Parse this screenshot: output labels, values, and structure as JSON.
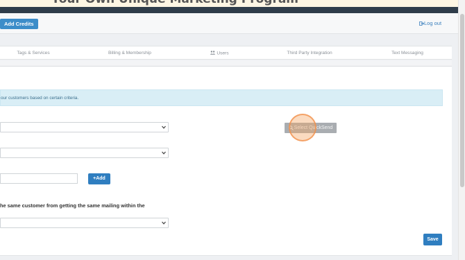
{
  "banner": {
    "text": "Your Own Unique Marketing Program"
  },
  "toolbar": {
    "add_credits_label": "Add Credits",
    "logout_label": "Log out"
  },
  "tabs": [
    {
      "label": "Tags & Services"
    },
    {
      "label": "Billing & Membership"
    },
    {
      "label": "Users"
    },
    {
      "label": "Third Party Integration"
    },
    {
      "label": "Text Messaging"
    }
  ],
  "info": {
    "text": "our customers based on certain criteria."
  },
  "buttons": {
    "select_quicksend": "Select QuickSend",
    "add": "+Add",
    "save": "Save"
  },
  "labels": {
    "same_customer": "he same customer from getting the same mailing within the"
  },
  "icons": {
    "logout": "logout-icon",
    "users": "users-icon",
    "search": "search-icon",
    "chevron": "chevron-down-icon"
  },
  "colors": {
    "primary": "#2f7ec0",
    "info_bg": "#d9eef6",
    "disabled_button": "#a9adb1",
    "click_indicator": "#f6a462",
    "dark_nav": "#2f3d4a"
  }
}
